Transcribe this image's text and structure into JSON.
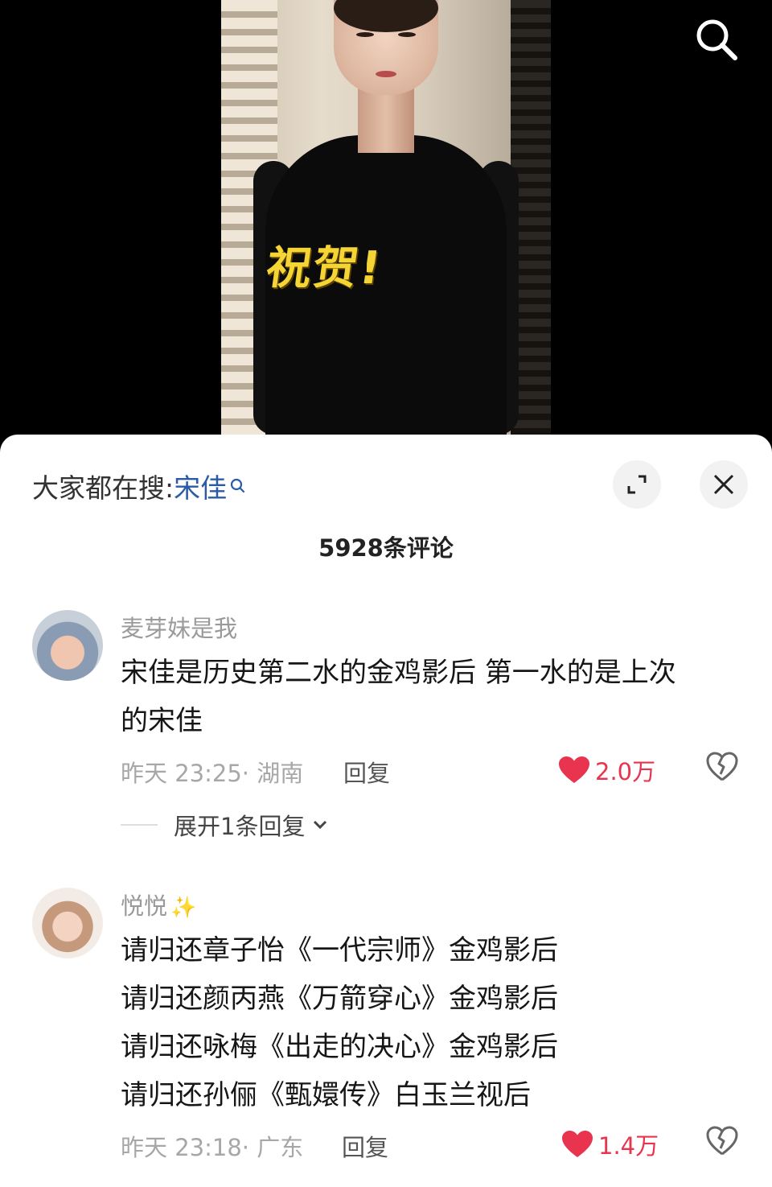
{
  "video": {
    "overlay_text": "祝贺!"
  },
  "sheet": {
    "search_prefix": "大家都在搜:",
    "search_keyword": "宋佳",
    "comment_count": "5928条评论"
  },
  "comments": [
    {
      "username": "麦芽妹是我",
      "lines": [
        "宋佳是历史第二水的金鸡影后  第一水的是上次",
        "的宋佳"
      ],
      "time": "昨天 23:25",
      "location": "· 湖南",
      "reply_label": "回复",
      "likes": "2.0万",
      "expand_replies": "展开1条回复"
    },
    {
      "username": "悦悦",
      "lines": [
        "请归还章子怡《一代宗师》金鸡影后",
        "请归还颜丙燕《万箭穿心》金鸡影后",
        "请归还咏梅《出走的决心》金鸡影后",
        "请归还孙俪《甄嬛传》白玉兰视后"
      ],
      "time": "昨天 23:18",
      "location": "· 广东",
      "reply_label": "回复",
      "likes": "1.4万"
    }
  ],
  "colors": {
    "like": "#e8344e",
    "keyword": "#2b5ba6",
    "overlay": "#f5d535"
  }
}
